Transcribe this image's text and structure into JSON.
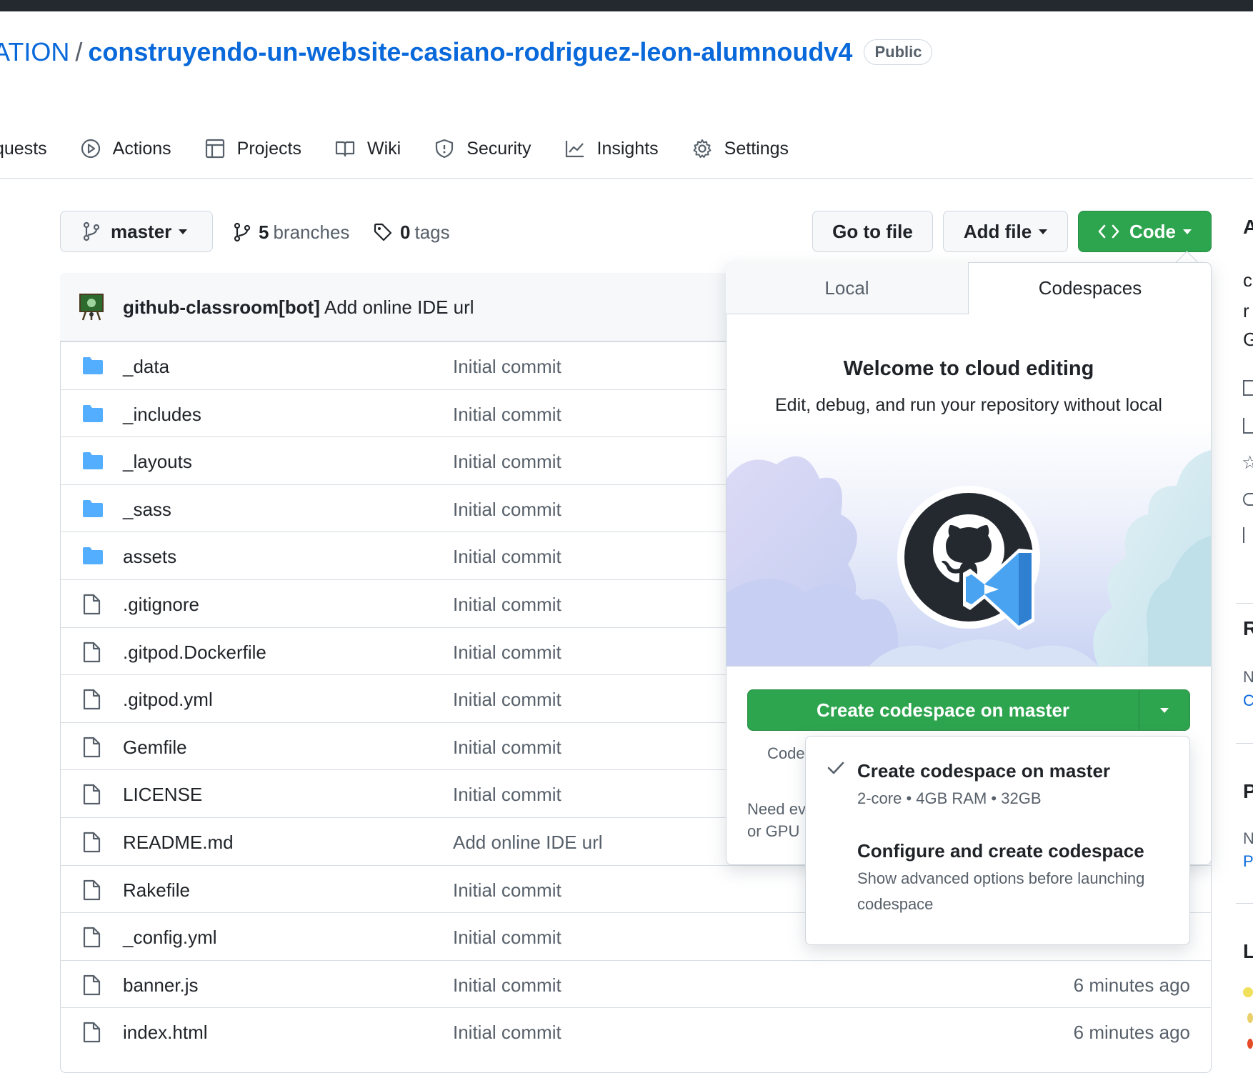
{
  "header": {
    "owner_partial": "ATION",
    "separator": "/",
    "repo_name": "construyendo-un-website-casiano-rodriguez-leon-alumnoudv4",
    "visibility_badge": "Public"
  },
  "nav": {
    "items": [
      {
        "label": "quests",
        "icon": "pull-request-icon"
      },
      {
        "label": "Actions",
        "icon": "play-icon"
      },
      {
        "label": "Projects",
        "icon": "table-icon"
      },
      {
        "label": "Wiki",
        "icon": "book-icon"
      },
      {
        "label": "Security",
        "icon": "shield-icon"
      },
      {
        "label": "Insights",
        "icon": "graph-icon"
      },
      {
        "label": "Settings",
        "icon": "gear-icon"
      }
    ]
  },
  "toolbar": {
    "branch": "master",
    "branches_count": "5",
    "branches_label": "branches",
    "tags_count": "0",
    "tags_label": "tags",
    "go_to_file": "Go to file",
    "add_file": "Add file",
    "code": "Code"
  },
  "latest_commit": {
    "author": "github-classroom[bot]",
    "message": "Add online IDE url"
  },
  "files": [
    {
      "type": "folder",
      "name": "_data",
      "message": "Initial commit",
      "age": ""
    },
    {
      "type": "folder",
      "name": "_includes",
      "message": "Initial commit",
      "age": ""
    },
    {
      "type": "folder",
      "name": "_layouts",
      "message": "Initial commit",
      "age": ""
    },
    {
      "type": "folder",
      "name": "_sass",
      "message": "Initial commit",
      "age": ""
    },
    {
      "type": "folder",
      "name": "assets",
      "message": "Initial commit",
      "age": ""
    },
    {
      "type": "file",
      "name": ".gitignore",
      "message": "Initial commit",
      "age": ""
    },
    {
      "type": "file",
      "name": ".gitpod.Dockerfile",
      "message": "Initial commit",
      "age": ""
    },
    {
      "type": "file",
      "name": ".gitpod.yml",
      "message": "Initial commit",
      "age": ""
    },
    {
      "type": "file",
      "name": "Gemfile",
      "message": "Initial commit",
      "age": ""
    },
    {
      "type": "file",
      "name": "LICENSE",
      "message": "Initial commit",
      "age": ""
    },
    {
      "type": "file",
      "name": "README.md",
      "message": "Add online IDE url",
      "age": ""
    },
    {
      "type": "file",
      "name": "Rakefile",
      "message": "Initial commit",
      "age": ""
    },
    {
      "type": "file",
      "name": "_config.yml",
      "message": "Initial commit",
      "age": ""
    },
    {
      "type": "file",
      "name": "banner.js",
      "message": "Initial commit",
      "age": "6 minutes ago"
    },
    {
      "type": "file",
      "name": "index.html",
      "message": "Initial commit",
      "age": "6 minutes ago"
    }
  ],
  "code_panel": {
    "tabs": [
      "Local",
      "Codespaces"
    ],
    "active_tab": "Codespaces",
    "welcome_title": "Welcome to cloud editing",
    "welcome_desc": "Edit, debug, and run your repository without local cloning and setup.",
    "create_button": "Create codespace on master",
    "partial_code_text": "Code",
    "partial_need_text": "Need ev",
    "partial_gpu_text": "or GPU"
  },
  "codespace_menu": {
    "items": [
      {
        "title": "Create codespace on master",
        "subtitle": "2-core • 4GB RAM • 32GB",
        "selected": true
      },
      {
        "title": "Configure and create codespace",
        "subtitle": "Show advanced options before launching codespace",
        "selected": false
      }
    ]
  },
  "sidebar_partial": {
    "about_initial": "A",
    "desc_chars": [
      "c",
      "r",
      "G"
    ],
    "releases_initial": "R",
    "releases_n": "N",
    "releases_c": "C",
    "packages_initial": "P",
    "packages_n": "N",
    "packages_p": "P",
    "languages_initial": "L"
  },
  "colors": {
    "link": "#0969da",
    "green": "#2da44e",
    "folder": "#54aeff",
    "muted": "#57606a"
  }
}
